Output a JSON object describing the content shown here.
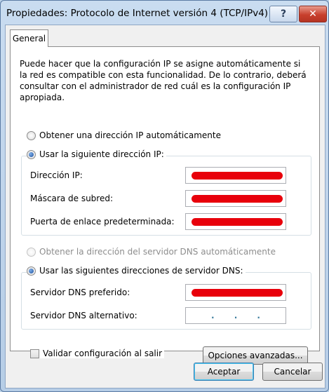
{
  "window": {
    "title": "Propiedades: Protocolo de Internet versión 4 (TCP/IPv4)",
    "help_label": "?",
    "close_label": "✕"
  },
  "tabs": [
    {
      "label": "General",
      "active": true
    }
  ],
  "intro_text": "Puede hacer que la configuración IP se asigne automáticamente si la red es compatible con esta funcionalidad. De lo contrario, deberá consultar con el administrador de red cuál es la configuración IP apropiada.",
  "ip_section": {
    "auto_label": "Obtener una dirección IP automáticamente",
    "manual_label": "Usar la siguiente dirección IP:",
    "selected": "manual",
    "fields": [
      {
        "label": "Dirección IP:",
        "redacted": true
      },
      {
        "label": "Máscara de subred:",
        "redacted": true
      },
      {
        "label": "Puerta de enlace predeterminada:",
        "redacted": true
      }
    ]
  },
  "dns_section": {
    "auto_label": "Obtener la dirección del servidor DNS automáticamente",
    "auto_enabled": false,
    "manual_label": "Usar las siguientes direcciones de servidor DNS:",
    "selected": "manual",
    "fields": [
      {
        "label": "Servidor DNS preferido:",
        "redacted": true
      },
      {
        "label": "Servidor DNS alternativo:",
        "redacted": false,
        "value": ". . ."
      }
    ]
  },
  "validate_label": "Validar configuración al salir",
  "validate_checked": false,
  "advanced_button": "Opciones avanzadas...",
  "ok_button": "Aceptar",
  "cancel_button": "Cancelar",
  "colors": {
    "redaction": "#e8000b",
    "title_bg": "#c9dcf0",
    "close_red": "#c8402d"
  }
}
